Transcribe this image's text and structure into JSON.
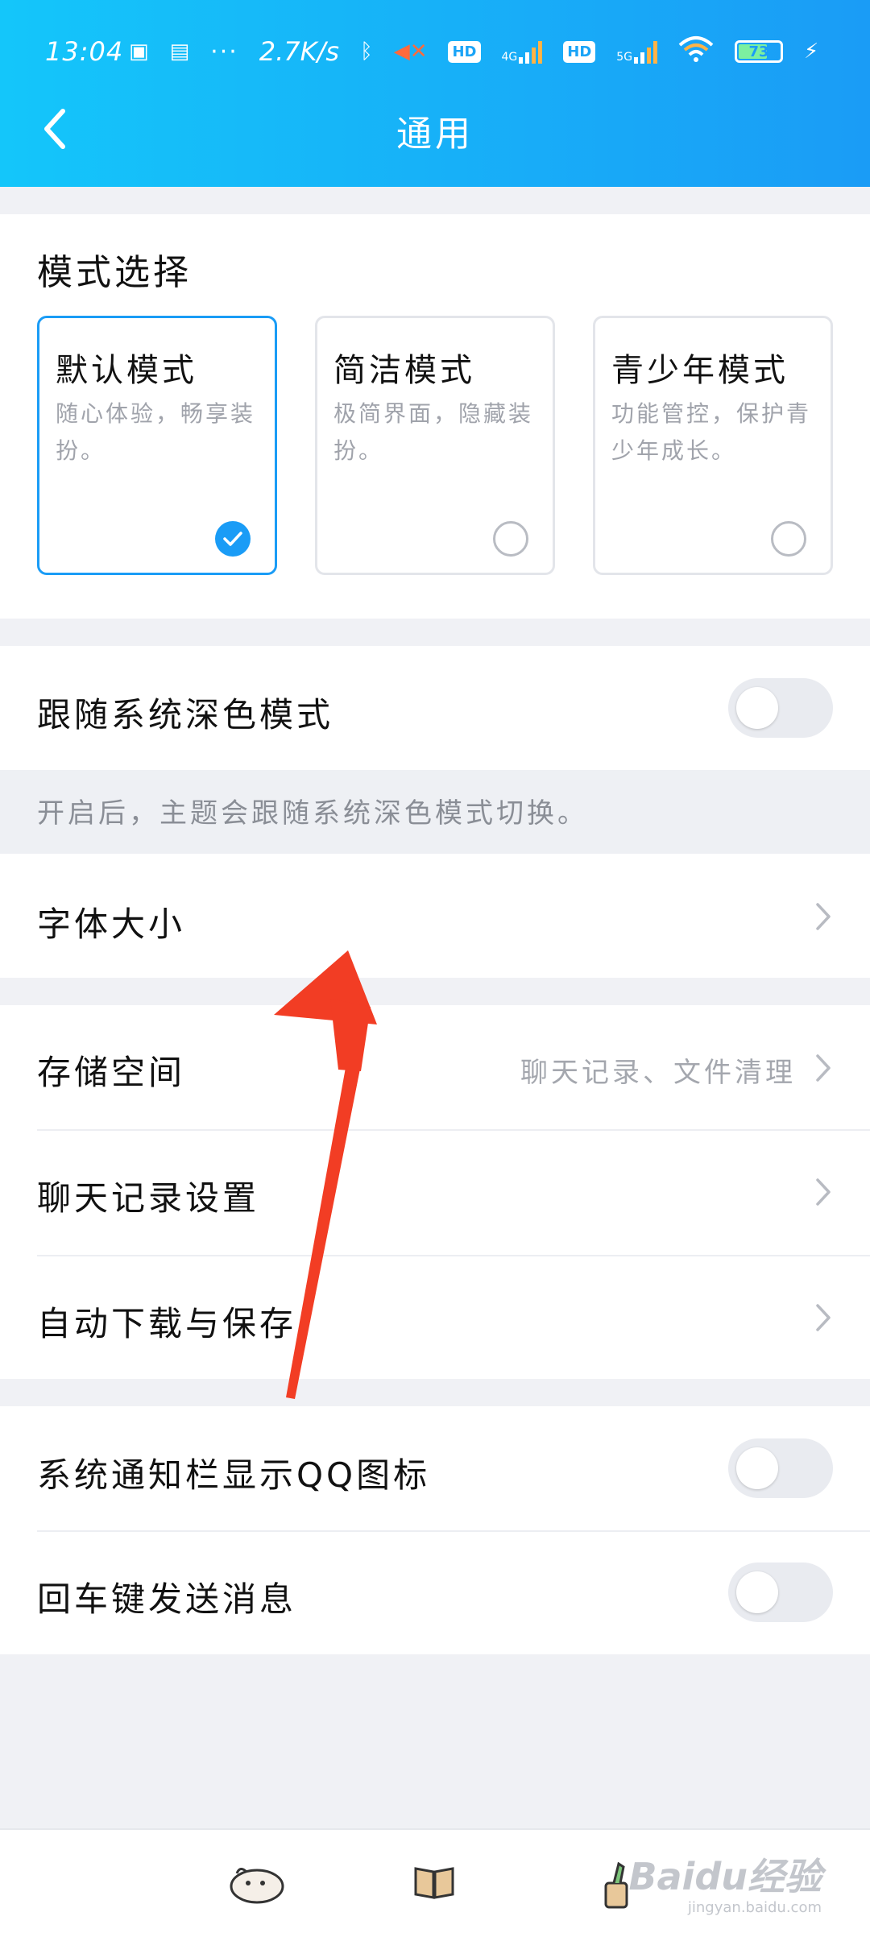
{
  "status_bar": {
    "time": "13:04",
    "dots": "···",
    "speed": "2.7K/s",
    "hd1": "HD",
    "net1": "4G",
    "hd2": "HD",
    "net2": "5G",
    "battery": "73"
  },
  "header": {
    "title": "通用",
    "back_icon": "chevron-left-icon"
  },
  "mode_section": {
    "heading": "模式选择",
    "cards": [
      {
        "title": "默认模式",
        "description": "随心体验，畅享装扮。",
        "selected": true
      },
      {
        "title": "简洁模式",
        "description": "极简界面，隐藏装扮。",
        "selected": false
      },
      {
        "title": "青少年模式",
        "description": "功能管控，保护青少年成长。",
        "selected": false
      }
    ]
  },
  "dark_mode": {
    "label": "跟随系统深色模式",
    "enabled": false,
    "hint": "开启后，主题会跟随系统深色模式切换。"
  },
  "font_size": {
    "label": "字体大小"
  },
  "storage_group": {
    "storage": {
      "label": "存储空间",
      "subtitle": "聊天记录、文件清理"
    },
    "chat_history": {
      "label": "聊天记录设置"
    },
    "auto_download": {
      "label": "自动下载与保存"
    }
  },
  "notify_group": {
    "qq_icon": {
      "label": "系统通知栏显示QQ图标",
      "enabled": false
    },
    "enter_send": {
      "label": "回车键发送消息",
      "enabled": false
    }
  },
  "bottom_bar": {
    "icons": [
      "penguin-icon",
      "book-icon",
      "pencil-cup-icon"
    ],
    "watermark_main": "Baidu经验",
    "watermark_sub": "jingyan.baidu.com"
  },
  "colors": {
    "accent": "#1a9cf6",
    "header_start": "#14c6fa",
    "annotation_arrow": "#f23d24"
  }
}
